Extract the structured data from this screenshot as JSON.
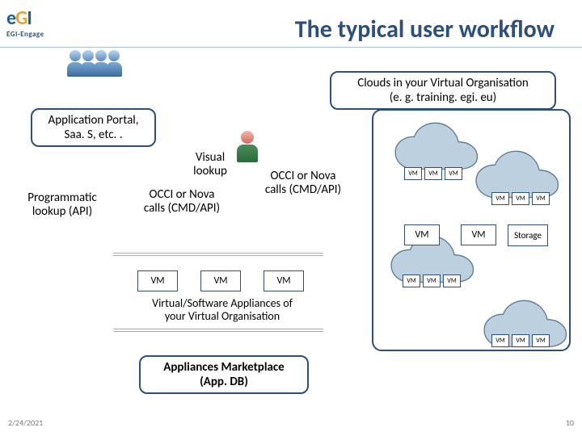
{
  "title": "The typical user workflow",
  "logo": {
    "brand_e": "e",
    "brand_g": "G",
    "brand_i": "I",
    "sub": "EGI-Engage"
  },
  "boxes": {
    "app_portal": "Application Portal,\nSaa. S, etc. .",
    "clouds_header": "Clouds in your Virtual Organisation\n(e. g. training. egi. eu)",
    "appliances_caption": "Virtual/Software Appliances of\nyour Virtual Organisation",
    "marketplace": "Appliances Marketplace\n(App. DB)"
  },
  "labels": {
    "programmatic": "Programmatic\nlookup (API)",
    "visual": "Visual\nlookup",
    "occi_left": "OCCI or Nova\ncalls (CMD/API)",
    "occi_right": "OCCI or Nova\ncalls (CMD/API)"
  },
  "vm_label": "VM",
  "storage_label": "Storage",
  "footer": {
    "date": "2/24/2021",
    "page": "10"
  }
}
